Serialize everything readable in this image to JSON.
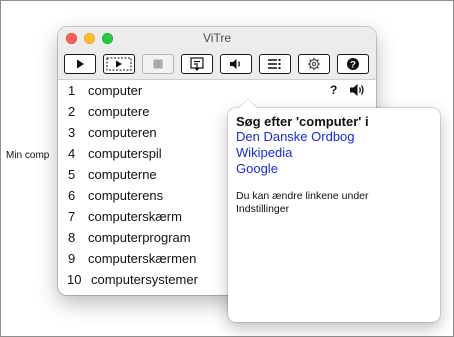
{
  "background": {
    "label": "Min comp"
  },
  "window": {
    "title": "ViTre",
    "toolbar": [
      {
        "name": "play-button",
        "icon": "play-icon",
        "enabled": true
      },
      {
        "name": "play-selection-button",
        "icon": "play-selection-icon",
        "enabled": true
      },
      {
        "name": "stop-button",
        "icon": "stop-icon",
        "enabled": false
      },
      {
        "name": "export-button",
        "icon": "export-icon",
        "enabled": true
      },
      {
        "name": "speak-button",
        "icon": "speaker-icon",
        "enabled": true
      },
      {
        "name": "list-button",
        "icon": "list-icon",
        "enabled": true
      },
      {
        "name": "settings-button",
        "icon": "gear-icon",
        "enabled": true
      },
      {
        "name": "help-button",
        "icon": "help-icon",
        "enabled": true
      }
    ]
  },
  "suggestions": [
    {
      "num": "1",
      "word": "computer",
      "help": "?"
    },
    {
      "num": "2",
      "word": "computere"
    },
    {
      "num": "3",
      "word": "computeren"
    },
    {
      "num": "4",
      "word": "computerspil"
    },
    {
      "num": "5",
      "word": "computerne"
    },
    {
      "num": "6",
      "word": "computerens"
    },
    {
      "num": "7",
      "word": "computerskærm"
    },
    {
      "num": "8",
      "word": "computerprogram"
    },
    {
      "num": "9",
      "word": "computerskærmen"
    },
    {
      "num": "10",
      "word": "computersystemer"
    }
  ],
  "popover": {
    "heading": "Søg efter 'computer' i",
    "links": [
      "Den Danske Ordbog",
      "Wikipedia",
      "Google"
    ],
    "note": "Du kan ændre linkene under Indstillinger"
  },
  "colors": {
    "link": "#1a29d8"
  }
}
